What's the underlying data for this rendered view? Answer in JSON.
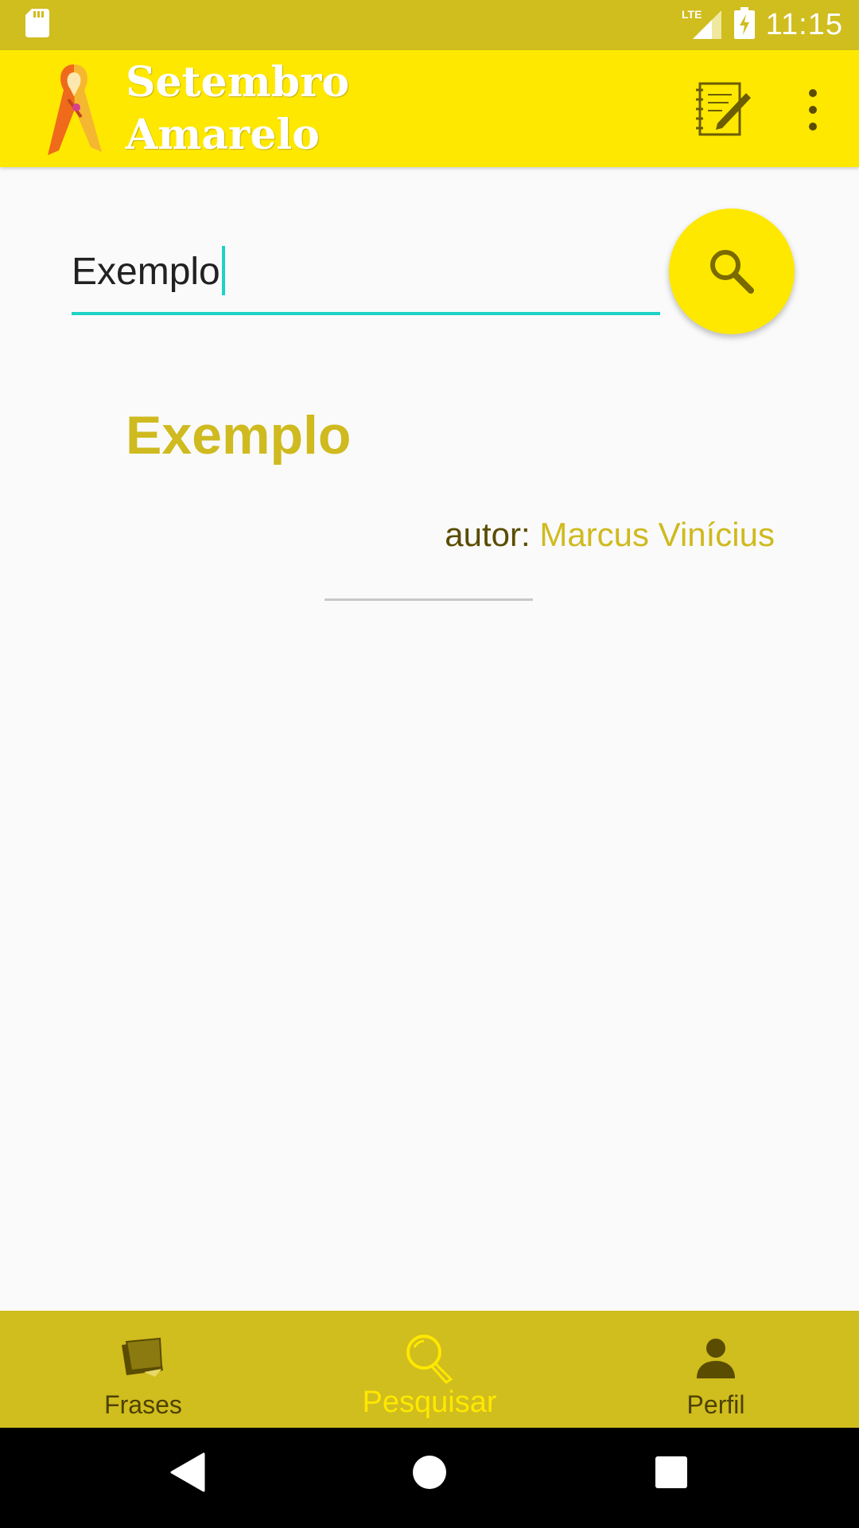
{
  "status_bar": {
    "time": "11:15",
    "network": "LTE",
    "icons": [
      "sd-card-icon",
      "lte-signal-icon",
      "battery-charging-icon"
    ]
  },
  "app_bar": {
    "title_line1": "Setembro",
    "title_line2": "Amarelo",
    "logo_icon": "ribbon-logo-icon",
    "actions": [
      "notes-edit-icon",
      "overflow-menu-icon"
    ]
  },
  "search": {
    "value": "Exemplo",
    "placeholder": "",
    "button_icon": "search-icon"
  },
  "result": {
    "title": "Exemplo",
    "author_prefix": "autor:",
    "author_name": "Marcus Vinícius"
  },
  "bottom_nav": {
    "items": [
      {
        "label": "Frases",
        "icon": "notes-stack-icon",
        "active": false
      },
      {
        "label": "Pesquisar",
        "icon": "magnifier-icon",
        "active": true
      },
      {
        "label": "Perfil",
        "icon": "person-icon",
        "active": false
      }
    ]
  },
  "colors": {
    "status_bar": "#d0bd1e",
    "app_bar": "#ffe800",
    "accent_teal": "#1ed2c6",
    "title_gold": "#cfba1f",
    "nav_bar": "#d0bd1e"
  }
}
